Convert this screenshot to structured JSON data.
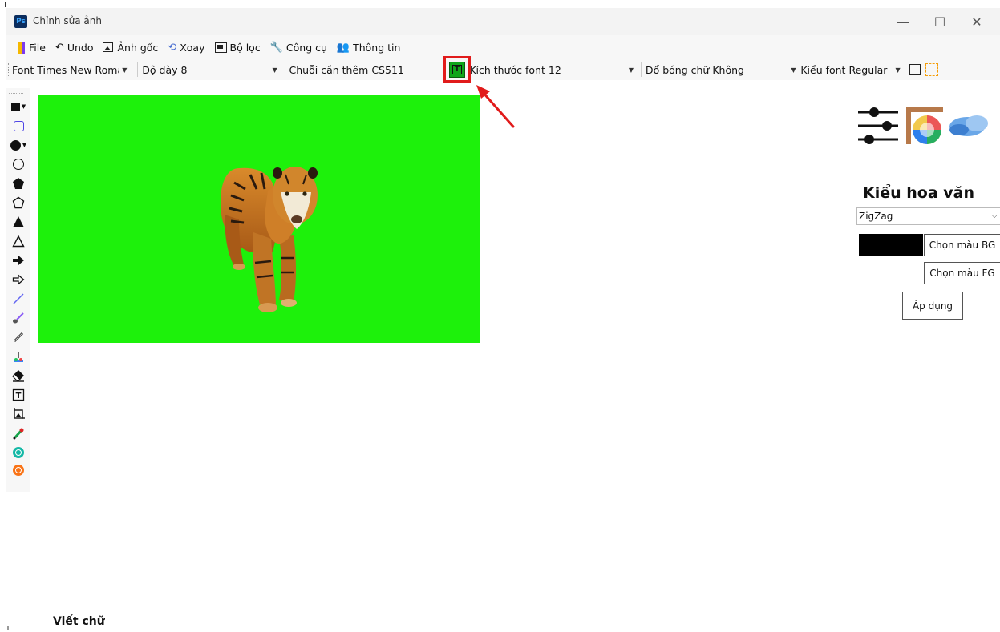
{
  "window": {
    "title": "Chỉnh sửa ảnh",
    "app_icon_text": "Ps",
    "controls": {
      "minimize": "—",
      "maximize": "☐",
      "close": "✕"
    }
  },
  "menu": {
    "items": [
      {
        "label": "File",
        "icon": "file-icon"
      },
      {
        "label": "Undo",
        "icon": "undo-icon"
      },
      {
        "label": "Ảnh gốc",
        "icon": "original-image-icon"
      },
      {
        "label": "Xoay",
        "icon": "rotate-icon"
      },
      {
        "label": "Bộ lọc",
        "icon": "filter-icon"
      },
      {
        "label": "Công cụ",
        "icon": "tools-icon"
      },
      {
        "label": "Thông tin",
        "icon": "info-icon"
      }
    ]
  },
  "toolbar": {
    "font_label": "Font",
    "font_value": "Times New Roman",
    "thickness_label": "Độ dày",
    "thickness_value": "8",
    "string_label": "Chuỗi cần thêm",
    "string_value": "CS511",
    "text_button_glyph": "T",
    "font_size_label": "Kích thước font",
    "font_size_value": "12",
    "shadow_label": "Đổ bóng chữ",
    "shadow_value": "Không",
    "font_style_label": "Kiểu font",
    "font_style_value": "Regular"
  },
  "tools": [
    "filled-rectangle-icon",
    "rounded-rectangle-icon",
    "filled-circle-icon",
    "circle-icon",
    "filled-pentagon-icon",
    "pentagon-icon",
    "filled-triangle-icon",
    "triangle-icon",
    "filled-arrow-icon",
    "arrow-icon",
    "line-icon",
    "brush-icon",
    "pencil-icon",
    "fill-icon",
    "eraser-icon",
    "text-icon",
    "crop-icon",
    "color-picker-icon",
    "zoom-in-icon",
    "zoom-out-icon"
  ],
  "canvas": {
    "background": "#1df10b",
    "subject": "tiger"
  },
  "right_panel": {
    "pattern_title": "Kiểu hoa văn",
    "pattern_value": "ZigZag",
    "bg_color": "#000000",
    "choose_bg_label": "Chọn màu BG",
    "choose_fg_label": "Chọn màu FG",
    "apply_label": "Áp dụng"
  },
  "status": {
    "label": "Viết chữ"
  },
  "colors": {
    "highlight": "#e11b1b",
    "text_button": "#10a51b",
    "canvas_green": "#1df10b"
  }
}
